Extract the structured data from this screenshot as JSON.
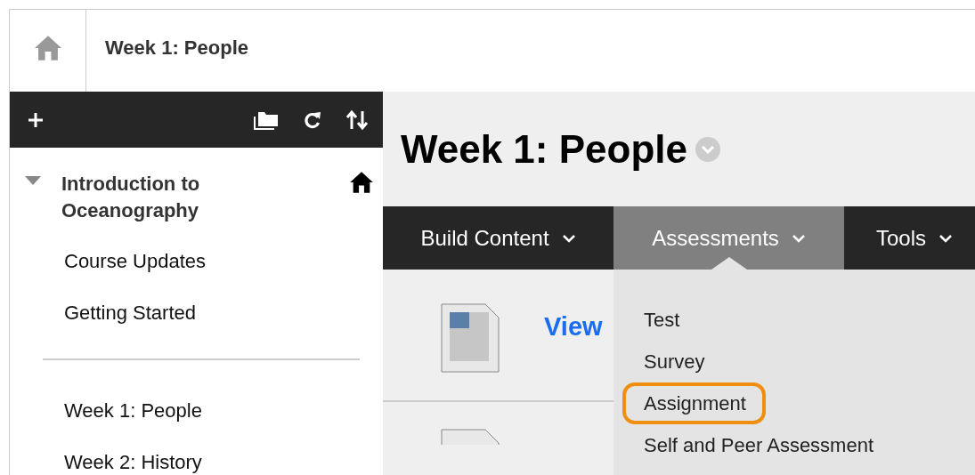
{
  "breadcrumb": {
    "title": "Week 1: People"
  },
  "sidebar": {
    "tree": [
      {
        "label": "Introduction to Oceanography",
        "expanded": true,
        "is_home": true,
        "children": [
          {
            "label": "Course Updates",
            "kind": "link"
          },
          {
            "label": "Getting Started",
            "kind": "link"
          },
          {
            "kind": "divider"
          },
          {
            "label": "Week 1: People",
            "kind": "link"
          },
          {
            "label": "Week 2: History",
            "kind": "link"
          }
        ]
      }
    ]
  },
  "content": {
    "title": "Week 1: People",
    "action_bar": [
      {
        "label": "Build Content",
        "selected": false
      },
      {
        "label": "Assessments",
        "selected": true
      },
      {
        "label": "Tools",
        "selected": false
      }
    ],
    "menu": [
      {
        "label": "Test",
        "highlighted": false
      },
      {
        "label": "Survey",
        "highlighted": false
      },
      {
        "label": "Assignment",
        "highlighted": true
      },
      {
        "label": "Self and Peer Assessment",
        "highlighted": false
      }
    ],
    "items": [
      {
        "title": "View"
      }
    ]
  }
}
